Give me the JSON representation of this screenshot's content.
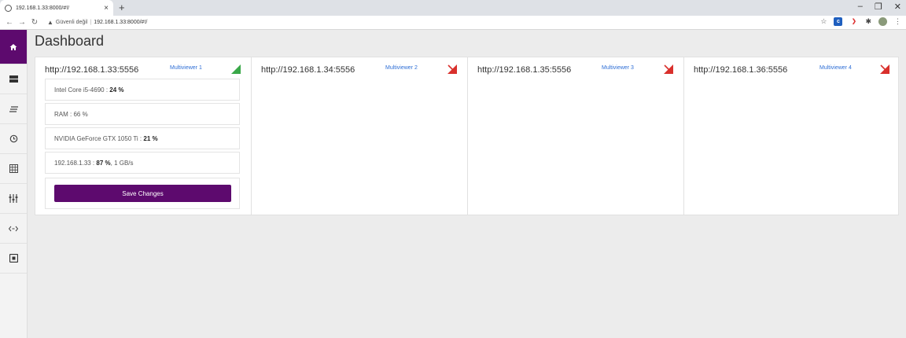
{
  "browser": {
    "tab_title": "192.168.1.33:8000/#!/",
    "tab_close": "×",
    "new_tab": "+",
    "minimize": "–",
    "maximize": "❐",
    "close": "✕",
    "security_label": "Güvenli değil",
    "url": "192.168.1.33:8000/#!/"
  },
  "page": {
    "title": "Dashboard"
  },
  "cards": [
    {
      "host": "http://192.168.1.33:5556",
      "label": "Multiviewer 1",
      "status": "connected",
      "metrics": {
        "cpu_label": "Intel Core i5-4690 : ",
        "cpu_value": "24 %",
        "ram": "RAM : 66 %",
        "gpu_label": "NVIDIA GeForce GTX 1050 Ti : ",
        "gpu_value": "21 %",
        "net_label": "192.168.1.33 : ",
        "net_value": "87 %",
        "net_rate": " , 1 GB/s"
      },
      "save_label": "Save Changes"
    },
    {
      "host": "http://192.168.1.34:5556",
      "label": "Multiviewer 2",
      "status": "disconnected"
    },
    {
      "host": "http://192.168.1.35:5556",
      "label": "Multiviewer 3",
      "status": "disconnected"
    },
    {
      "host": "http://192.168.1.36:5556",
      "label": "Multiviewer 4",
      "status": "disconnected"
    }
  ],
  "colors": {
    "accent": "#5d0a6e",
    "connected": "#3aa849",
    "disconnected": "#d9302c",
    "link": "#2f6fd6"
  }
}
